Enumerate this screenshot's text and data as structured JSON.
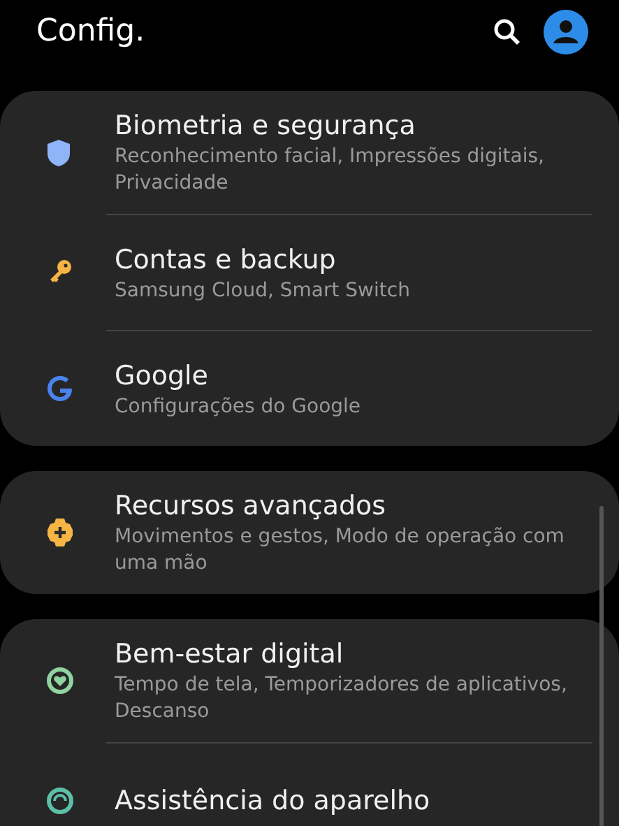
{
  "header": {
    "title": "Config."
  },
  "groups": [
    {
      "items": [
        {
          "title": "Biometria e segurança",
          "subtitle": "Reconhecimento facial, Impressões digitais, Privacidade"
        },
        {
          "title": "Contas e backup",
          "subtitle": "Samsung Cloud, Smart Switch"
        },
        {
          "title": "Google",
          "subtitle": "Configurações do Google"
        }
      ]
    },
    {
      "items": [
        {
          "title": "Recursos avançados",
          "subtitle": "Movimentos e gestos, Modo de operação com uma mão"
        }
      ]
    },
    {
      "items": [
        {
          "title": "Bem-estar digital",
          "subtitle": "Tempo de tela, Temporizadores de aplicativos, Descanso"
        },
        {
          "title": "Assistência do aparelho"
        }
      ]
    }
  ]
}
